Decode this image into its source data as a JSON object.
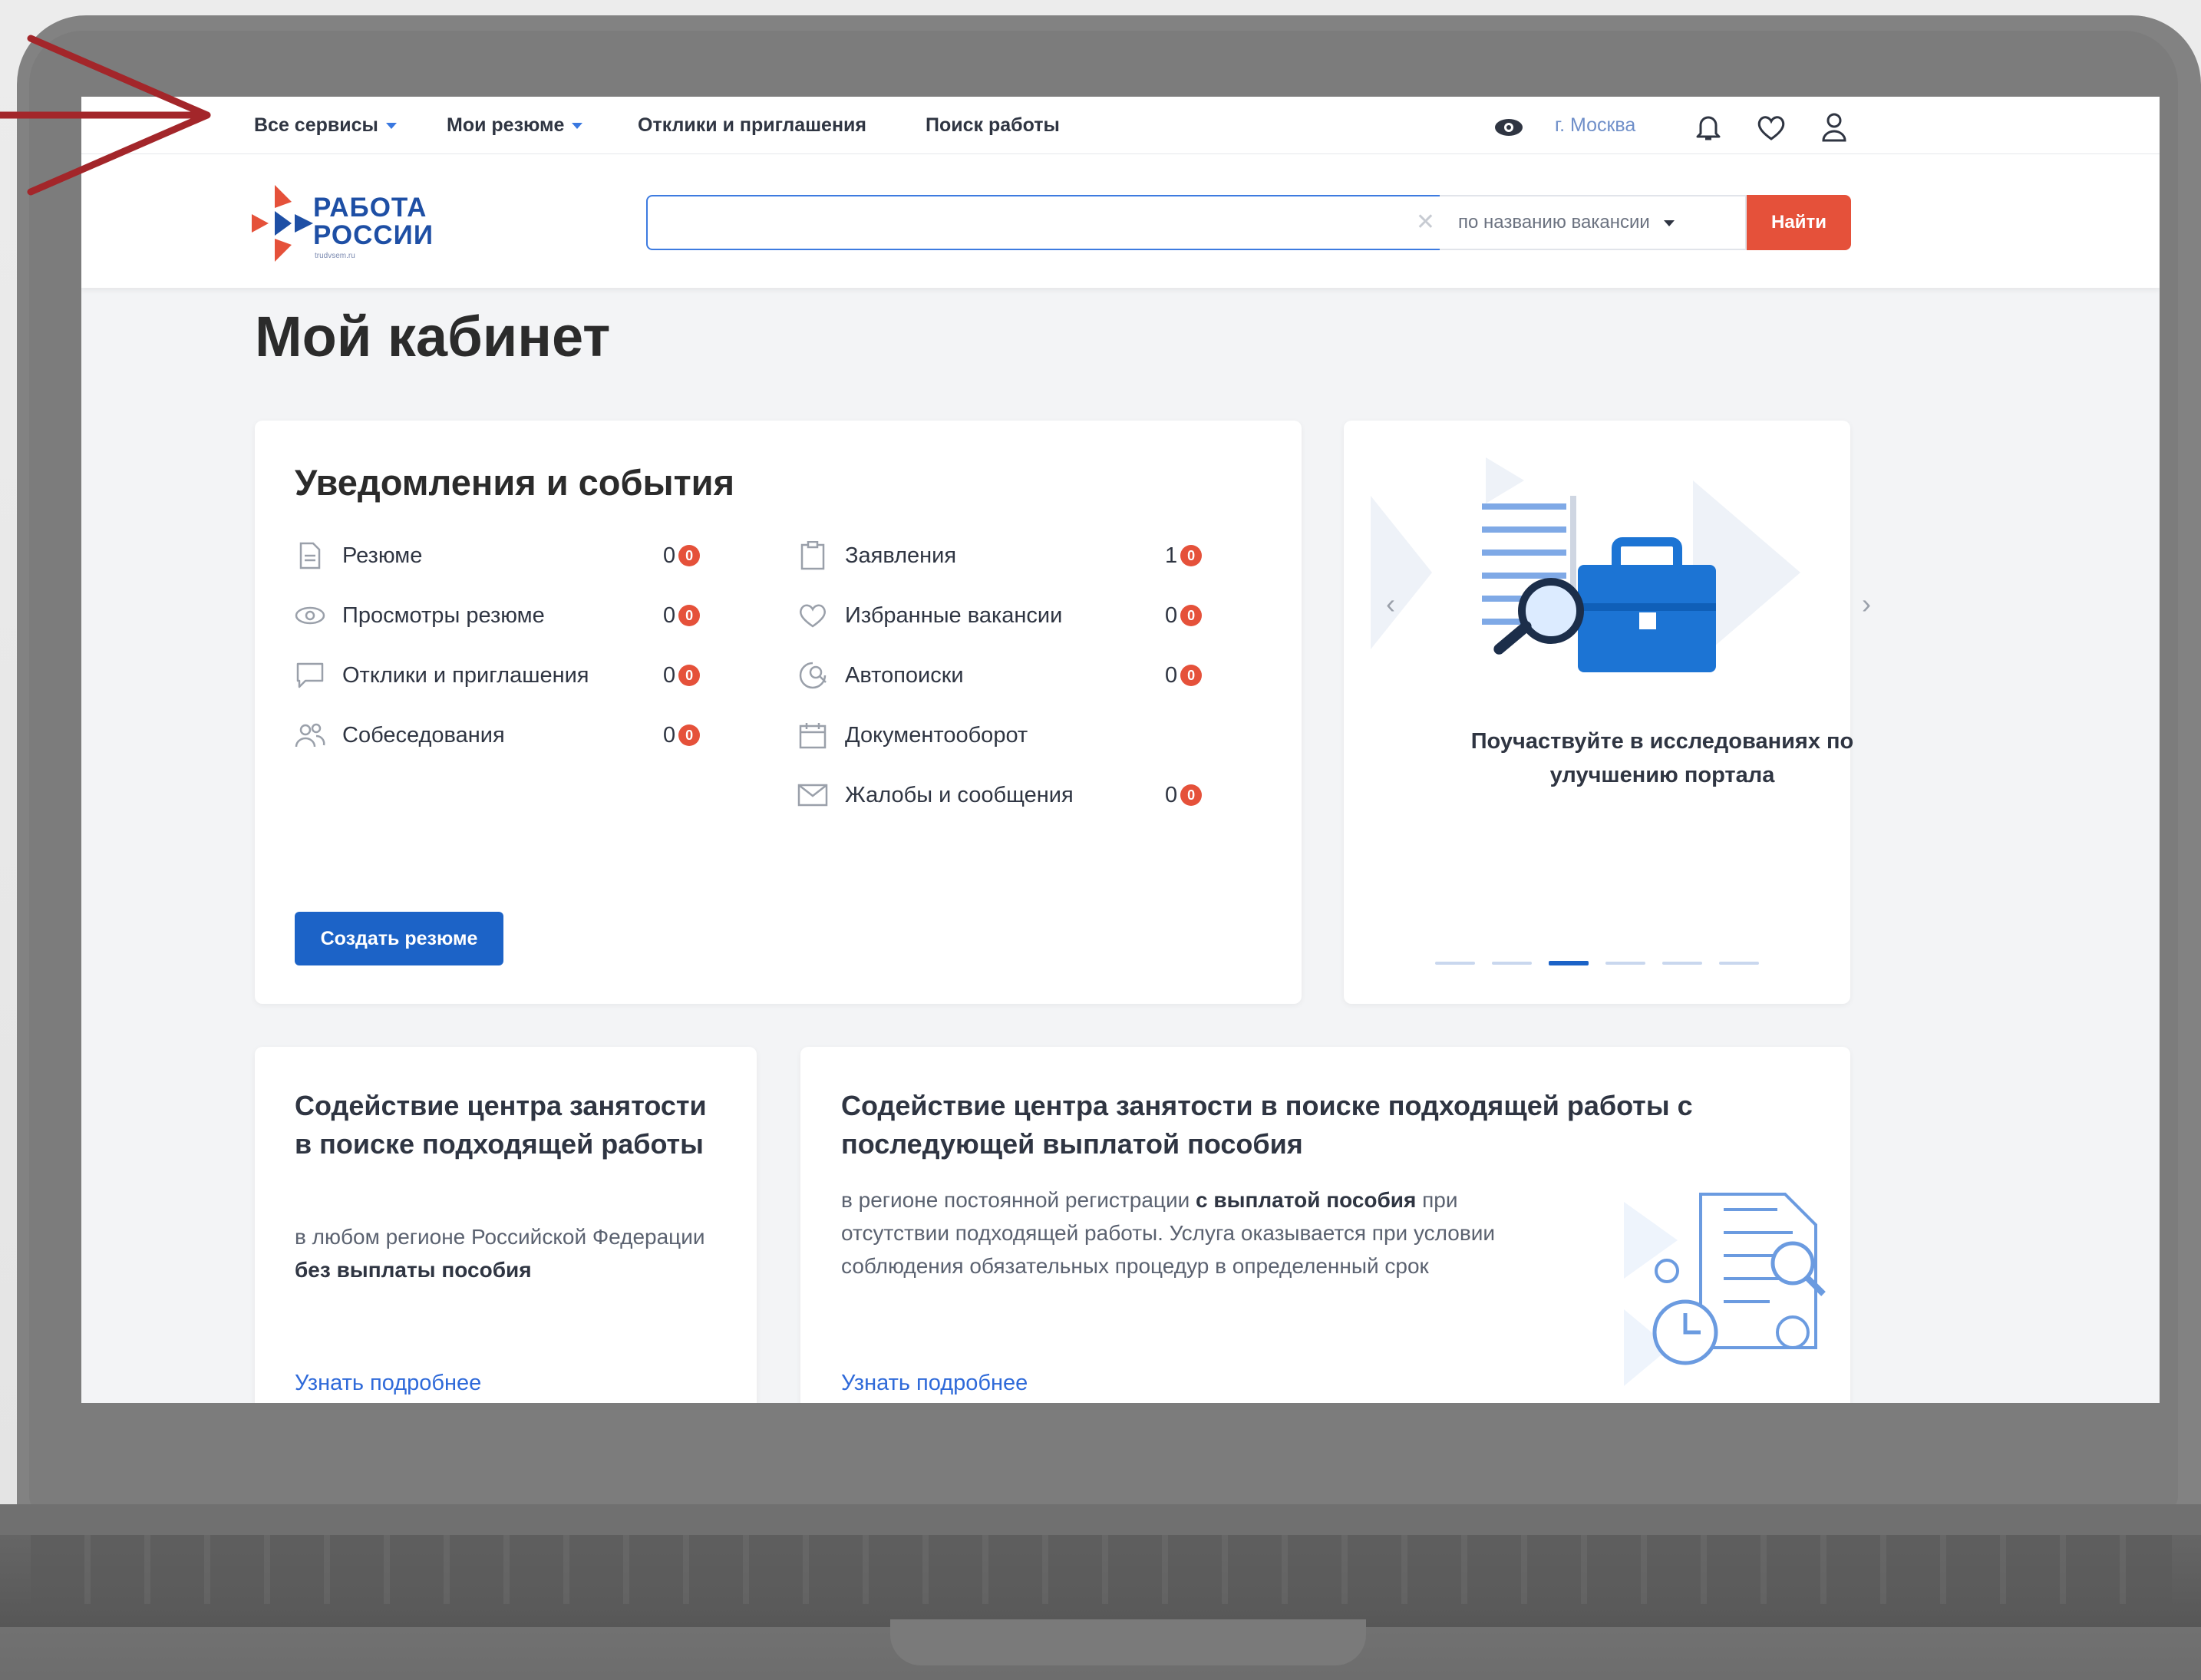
{
  "topnav": {
    "all_services": "Все сервисы",
    "my_resumes": "Мои резюме",
    "responses": "Отклики и приглашения",
    "job_search": "Поиск работы",
    "city": "г. Москва"
  },
  "header": {
    "logo_line1": "РАБОТА",
    "logo_line2": "РОССИИ",
    "logo_sub": "trudvsem.ru",
    "search_value": "",
    "search_type": "по названию вакансии",
    "find_button": "Найти"
  },
  "page": {
    "title": "Мой кабинет"
  },
  "notifications": {
    "title": "Уведомления и события",
    "left": [
      {
        "label": "Резюме",
        "count": "0",
        "badge": "0",
        "icon": "document-icon"
      },
      {
        "label": "Просмотры резюме",
        "count": "0",
        "badge": "0",
        "icon": "eye-icon"
      },
      {
        "label": "Отклики и приглашения",
        "count": "0",
        "badge": "0",
        "icon": "chat-icon"
      },
      {
        "label": "Собеседования",
        "count": "0",
        "badge": "0",
        "icon": "people-icon"
      }
    ],
    "right": [
      {
        "label": "Заявления",
        "count": "1",
        "badge": "0",
        "icon": "clipboard-icon"
      },
      {
        "label": "Избранные вакансии",
        "count": "0",
        "badge": "0",
        "icon": "heart-icon"
      },
      {
        "label": "Автопоиски",
        "count": "0",
        "badge": "0",
        "icon": "autosearch-icon"
      },
      {
        "label": "Документооборот",
        "count": "",
        "badge": "",
        "icon": "calendar-icon"
      },
      {
        "label": "Жалобы и сообщения",
        "count": "0",
        "badge": "0",
        "icon": "envelope-icon"
      }
    ],
    "create_resume": "Создать резюме"
  },
  "promo": {
    "text": "Поучаствуйте в исследованиях по улучшению портала",
    "dots": 6,
    "active_dot": 3
  },
  "services": [
    {
      "title": "Содействие центра занятости в поиске подходящей работы",
      "desc_plain": "в любом регионе Российской Федерации ",
      "desc_bold": "без выплаты пособия",
      "link": "Узнать подробнее"
    },
    {
      "title": "Содействие центра занятости в поиске подходящей работы с последующей выплатой пособия",
      "desc_plain1": "в регионе постоянной регистрации ",
      "desc_bold": "с выплатой пособия",
      "desc_plain2": " при отсутствии подходящей работы. Услуга оказывается при условии соблюдения обязательных процедур в определенный срок",
      "link": "Узнать подробнее"
    }
  ],
  "colors": {
    "accent_blue": "#1c63c7",
    "accent_red": "#e5513a",
    "annotation_arrow": "#a3262a"
  }
}
